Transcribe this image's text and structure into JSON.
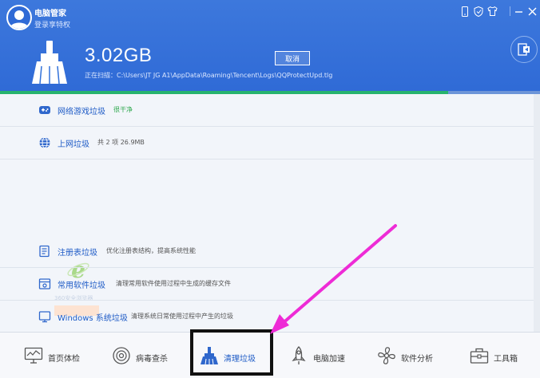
{
  "header": {
    "app_title": "电脑管家",
    "login_link": "登录享特权",
    "scan_size": "3.02GB",
    "cancel_label": "取消",
    "scan_path": "正在扫描：C:\\Users\\JT JG A1\\AppData\\Roaming\\Tencent\\Logs\\QQProtectUpd.tlg",
    "progress": 0.83
  },
  "titlebar_icons": [
    "phone-icon",
    "shield-icon",
    "shirt-icon",
    "minimize-icon",
    "close-icon"
  ],
  "rows": [
    {
      "name": "网络游戏垃圾",
      "desc": "很干净",
      "icon": "gamepad-icon"
    },
    {
      "name": "上网垃圾",
      "desc": "共 2 项 26.9MB",
      "icon": "globe-icon"
    },
    {
      "name": "注册表垃圾",
      "desc": "优化注册表结构，提高系统性能",
      "icon": "registry-icon"
    },
    {
      "name": "常用软件垃圾",
      "desc": "清理常用软件使用过程中生成的缓存文件",
      "icon": "software-icon"
    },
    {
      "name": "Windows 系统垃圾",
      "desc": "清理系统日常使用过程中产生的垃圾",
      "icon": "windows-icon"
    }
  ],
  "ie_tile": {
    "label": "360安全浏览器"
  },
  "nav": [
    {
      "label": "首页体检",
      "icon": "monitor-icon"
    },
    {
      "label": "病毒查杀",
      "icon": "virus-scan-icon"
    },
    {
      "label": "清理垃圾",
      "icon": "broom-icon"
    },
    {
      "label": "电脑加速",
      "icon": "rocket-icon"
    },
    {
      "label": "软件分析",
      "icon": "fan-icon"
    },
    {
      "label": "工具箱",
      "icon": "toolbox-icon"
    }
  ],
  "colors": {
    "header_blue": "#3272da",
    "link_blue": "#1e5bc6",
    "progress_green": "#27b36e",
    "annotation_magenta": "#ee2bd6",
    "highlight_border": "#111111"
  }
}
